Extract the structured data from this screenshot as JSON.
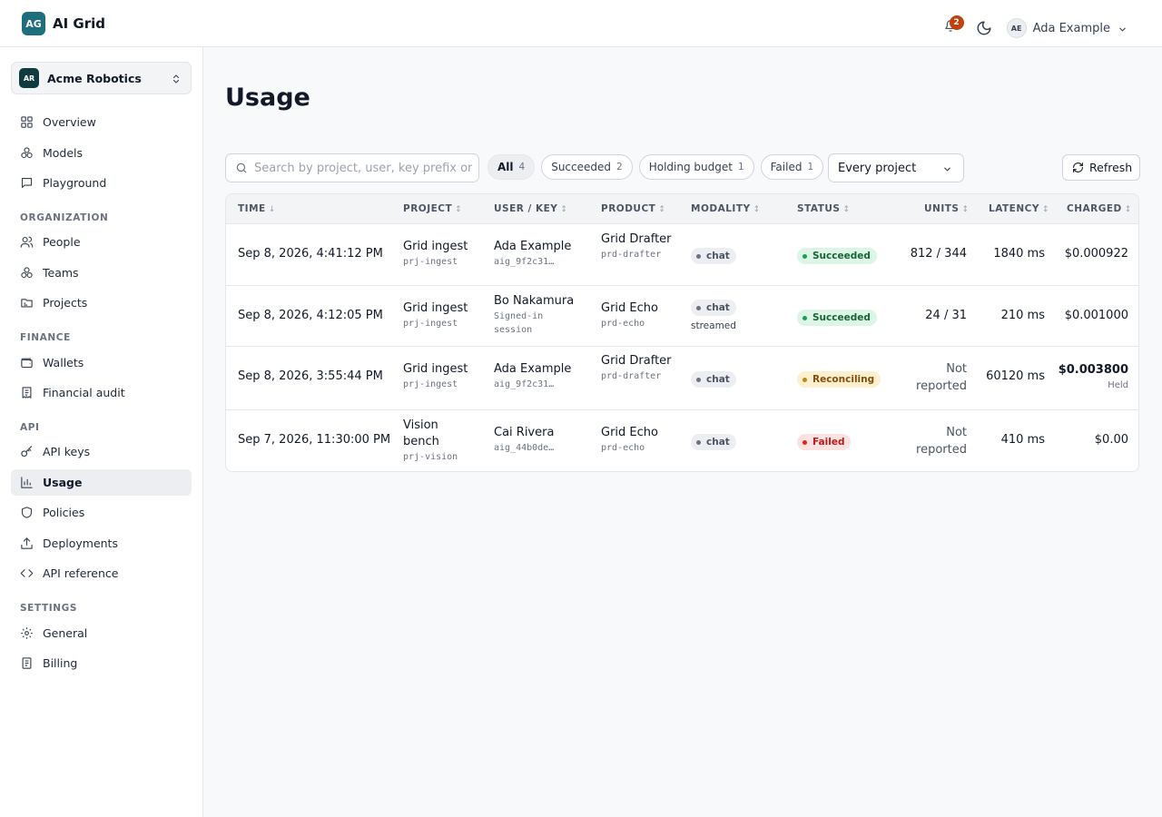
{
  "app": {
    "badge": "AG",
    "name": "AI Grid"
  },
  "header": {
    "notification_count": "2",
    "user_initials": "AE",
    "user_name": "Ada Example"
  },
  "org": {
    "badge": "AR",
    "name": "Acme Robotics"
  },
  "sidebar": {
    "top_items": [
      {
        "label": "Overview",
        "icon": "grid-icon"
      },
      {
        "label": "Models",
        "icon": "models-icon"
      },
      {
        "label": "Playground",
        "icon": "chat-icon"
      }
    ],
    "sections": [
      {
        "title": "ORGANIZATION",
        "items": [
          {
            "label": "People",
            "icon": "people-icon"
          },
          {
            "label": "Teams",
            "icon": "teams-icon"
          },
          {
            "label": "Projects",
            "icon": "folder-icon"
          }
        ]
      },
      {
        "title": "FINANCE",
        "items": [
          {
            "label": "Wallets",
            "icon": "wallet-icon"
          },
          {
            "label": "Financial audit",
            "icon": "receipt-icon"
          }
        ]
      },
      {
        "title": "API",
        "items": [
          {
            "label": "API keys",
            "icon": "key-icon"
          },
          {
            "label": "Usage",
            "icon": "bar-chart-icon",
            "active": true
          },
          {
            "label": "Policies",
            "icon": "shield-icon"
          },
          {
            "label": "Deployments",
            "icon": "upload-icon"
          },
          {
            "label": "API reference",
            "icon": "code-icon"
          }
        ]
      },
      {
        "title": "SETTINGS",
        "items": [
          {
            "label": "General",
            "icon": "gear-icon"
          },
          {
            "label": "Billing",
            "icon": "invoice-icon"
          }
        ]
      }
    ]
  },
  "page": {
    "title": "Usage"
  },
  "filters": {
    "search_placeholder": "Search by project, user, key prefix or",
    "chips": [
      {
        "label": "All",
        "count": "4",
        "active": true
      },
      {
        "label": "Succeeded",
        "count": "2"
      },
      {
        "label": "Holding budget",
        "count": "1"
      },
      {
        "label": "Failed",
        "count": "1"
      }
    ],
    "project_select": "Every project",
    "refresh_label": "Refresh"
  },
  "table": {
    "headers": {
      "time": "TIME",
      "project": "PROJECT",
      "user_key": "USER / KEY",
      "product": "PRODUCT",
      "modality": "MODALITY",
      "status": "STATUS",
      "units": "UNITS",
      "latency": "LATENCY",
      "charged": "CHARGED"
    },
    "sort_time": "↓",
    "sort_other": "↕",
    "rows": [
      {
        "time": "Sep 8, 2026, 4:41:12 PM",
        "project": "Grid ingest",
        "project_id": "prj-ingest",
        "user": "Ada Example",
        "key": "aig_9f2c31…",
        "product": "Grid Drafter",
        "product_id": "prd-drafter",
        "modality": "chat",
        "modality_note": "",
        "status": "Succeeded",
        "units": "812 / 344",
        "latency": "1840 ms",
        "charged": "$0.000922",
        "charged_note": ""
      },
      {
        "time": "Sep 8, 2026, 4:12:05 PM",
        "project": "Grid ingest",
        "project_id": "prj-ingest",
        "user": "Bo Nakamura",
        "key": "Signed-in session",
        "product": "Grid Echo",
        "product_id": "prd-echo",
        "modality": "chat",
        "modality_note": "streamed",
        "status": "Succeeded",
        "units": "24 / 31",
        "latency": "210 ms",
        "charged": "$0.001000",
        "charged_note": ""
      },
      {
        "time": "Sep 8, 2026, 3:55:44 PM",
        "project": "Grid ingest",
        "project_id": "prj-ingest",
        "user": "Ada Example",
        "key": "aig_9f2c31…",
        "product": "Grid Drafter",
        "product_id": "prd-drafter",
        "modality": "chat",
        "modality_note": "",
        "status": "Reconciling",
        "units": "Not reported",
        "latency": "60120 ms",
        "charged": "$0.003800",
        "charged_note": "Held"
      },
      {
        "time": "Sep 7, 2026, 11:30:00 PM",
        "project": "Vision bench",
        "project_id": "prj-vision",
        "user": "Cai Rivera",
        "key": "aig_44b0de…",
        "product": "Grid Echo",
        "product_id": "prd-echo",
        "modality": "chat",
        "modality_note": "",
        "status": "Failed",
        "units": "Not reported",
        "latency": "410 ms",
        "charged": "$0.00",
        "charged_note": ""
      }
    ]
  },
  "colors": {
    "brand": "#1f6e7e",
    "notification": "#c2410c",
    "success": "#16a34a",
    "warning": "#b58a1a",
    "danger": "#dc2626"
  }
}
